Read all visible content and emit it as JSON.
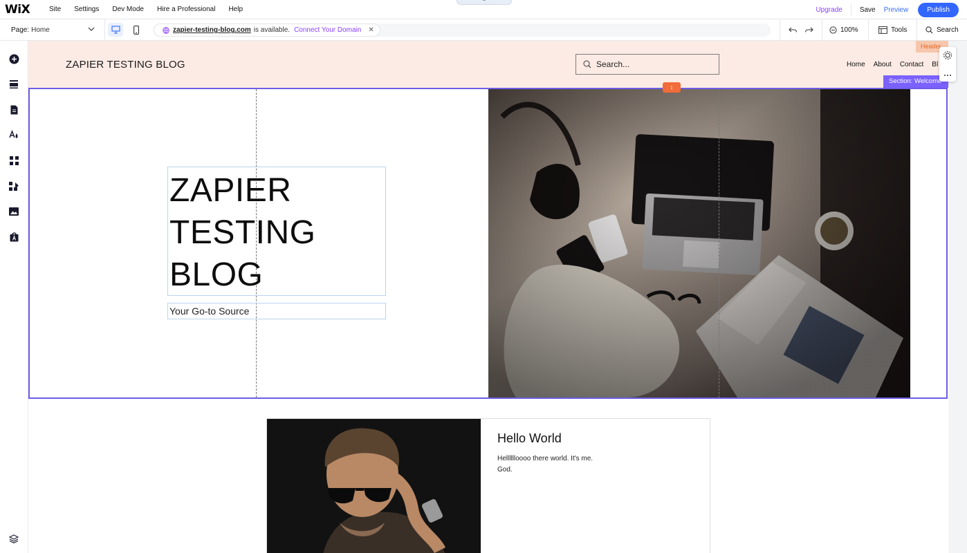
{
  "topbar": {
    "logo": "WiX",
    "menu": [
      "Site",
      "Settings",
      "Dev Mode",
      "Hire a Professional",
      "Help"
    ],
    "upgrade": "Upgrade",
    "save": "Save",
    "preview": "Preview",
    "publish": "Publish"
  },
  "toolbar": {
    "page_label": "Page:",
    "page_value": "Home",
    "domain": "zapier-testing-blog.com",
    "available": "is available.",
    "connect": "Connect Your Domain",
    "zoom": "100%",
    "tools": "Tools",
    "search": "Search"
  },
  "site": {
    "header_title": "ZAPIER TESTING BLOG",
    "search_placeholder": "Search...",
    "nav": [
      "Home",
      "About",
      "Contact",
      "Bl"
    ],
    "header_tag": "Header",
    "section_tag": "Section: Welcome",
    "hero_title_lines": [
      "ZAPIER",
      "TESTING",
      "BLOG"
    ],
    "hero_subtitle": "Your Go-to Source",
    "card_title": "Hello World",
    "card_text_line1": "Helllllloooo there world. It's me.",
    "card_text_line2": "God."
  },
  "colors": {
    "accent": "#3366ff",
    "upgrade": "#8a3ffc",
    "header_bg": "#fcebe4",
    "section_border": "#6c5ce7",
    "drag_handle": "#f26b3a"
  },
  "leftbar_icons": [
    "add-icon",
    "sections-icon",
    "pages-icon",
    "design-icon",
    "apps-icon",
    "business-icon",
    "media-icon",
    "app-market-icon",
    "layers-icon"
  ]
}
